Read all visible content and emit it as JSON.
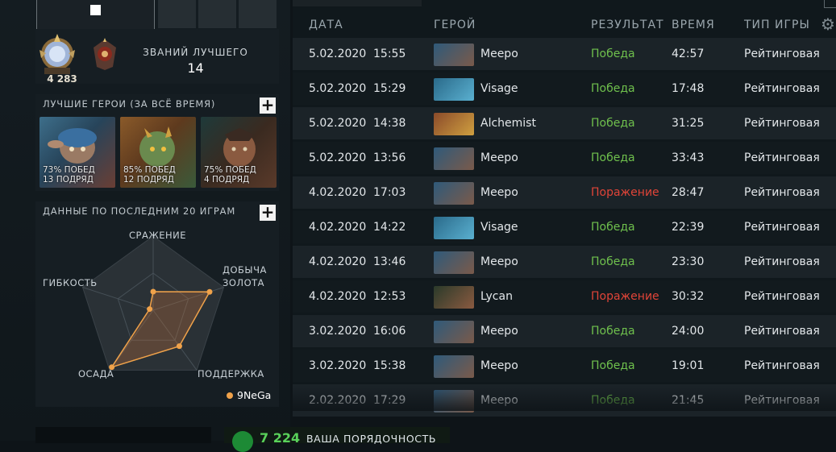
{
  "profile": {
    "rank_number": "4 283",
    "best_label": "ЗВАНИЙ ЛУЧШЕГО",
    "best_value": "14"
  },
  "best_heroes": {
    "title": "ЛУЧШИЕ ГЕРОИ (ЗА ВСЁ ВРЕМЯ)",
    "add_label": "+",
    "cards": [
      {
        "name": "Meepo",
        "winrate": "73% ПОБЕД",
        "streak": "13 ПОДРЯД"
      },
      {
        "name": "Alchemist",
        "winrate": "85% ПОБЕД",
        "streak": "12 ПОДРЯД"
      },
      {
        "name": "Lycan",
        "winrate": "75% ПОБЕД",
        "streak": "4 ПОДРЯД"
      }
    ]
  },
  "recent_stats": {
    "title": "ДАННЫЕ ПО ПОСЛЕДНИМ 20 ИГРАМ",
    "add_label": "+",
    "labels": {
      "fighting": "СРАЖЕНИЕ",
      "farming_1": "ДОБЫЧА",
      "farming_2": "ЗОЛОТА",
      "versatility": "ГИБКОСТЬ",
      "pushing": "ОСАДА",
      "support": "ПОДДЕРЖКА"
    },
    "legend": "9NeGa",
    "accent": "#f0a24a"
  },
  "chart_data": {
    "type": "radar",
    "axes": [
      "СРАЖЕНИЕ",
      "ДОБЫЧА ЗОЛОТА",
      "ПОДДЕРЖКА",
      "ОСАДА",
      "ГИБКОСТЬ"
    ],
    "series": [
      {
        "name": "9NeGa",
        "values": [
          0.25,
          0.8,
          0.6,
          0.95,
          0.05
        ]
      }
    ],
    "range": [
      0,
      1
    ]
  },
  "matches": {
    "headers": {
      "date": "ДАТА",
      "hero": "ГЕРОЙ",
      "result": "РЕЗУЛЬТАТ",
      "duration": "ВРЕМЯ",
      "game_type": "ТИП ИГРЫ"
    },
    "settings_icon": "gear-icon",
    "rows": [
      {
        "date": "5.02.2020",
        "time": "15:55",
        "hero": "Meepo",
        "result": "Победа",
        "win": true,
        "duration": "42:57",
        "type": "Рейтинговая"
      },
      {
        "date": "5.02.2020",
        "time": "15:29",
        "hero": "Visage",
        "result": "Победа",
        "win": true,
        "duration": "17:48",
        "type": "Рейтинговая"
      },
      {
        "date": "5.02.2020",
        "time": "14:38",
        "hero": "Alchemist",
        "result": "Победа",
        "win": true,
        "duration": "31:25",
        "type": "Рейтинговая"
      },
      {
        "date": "5.02.2020",
        "time": "13:56",
        "hero": "Meepo",
        "result": "Победа",
        "win": true,
        "duration": "33:43",
        "type": "Рейтинговая"
      },
      {
        "date": "4.02.2020",
        "time": "17:03",
        "hero": "Meepo",
        "result": "Поражение",
        "win": false,
        "duration": "28:47",
        "type": "Рейтинговая"
      },
      {
        "date": "4.02.2020",
        "time": "14:22",
        "hero": "Visage",
        "result": "Победа",
        "win": true,
        "duration": "22:39",
        "type": "Рейтинговая"
      },
      {
        "date": "4.02.2020",
        "time": "13:46",
        "hero": "Meepo",
        "result": "Победа",
        "win": true,
        "duration": "23:30",
        "type": "Рейтинговая"
      },
      {
        "date": "4.02.2020",
        "time": "12:53",
        "hero": "Lycan",
        "result": "Поражение",
        "win": false,
        "duration": "30:32",
        "type": "Рейтинговая"
      },
      {
        "date": "3.02.2020",
        "time": "16:06",
        "hero": "Meepo",
        "result": "Победа",
        "win": true,
        "duration": "24:00",
        "type": "Рейтинговая"
      },
      {
        "date": "3.02.2020",
        "time": "15:38",
        "hero": "Meepo",
        "result": "Победа",
        "win": true,
        "duration": "19:01",
        "type": "Рейтинговая"
      },
      {
        "date": "2.02.2020",
        "time": "17:29",
        "hero": "Meepo",
        "result": "Победа",
        "win": true,
        "duration": "21:45",
        "type": "Рейтинговая"
      }
    ],
    "colors": {
      "win": "#6fc04d",
      "loss": "#e04438"
    }
  },
  "conduct": {
    "score": "7 224",
    "label": "ВАША ПОРЯДОЧНОСТЬ"
  }
}
